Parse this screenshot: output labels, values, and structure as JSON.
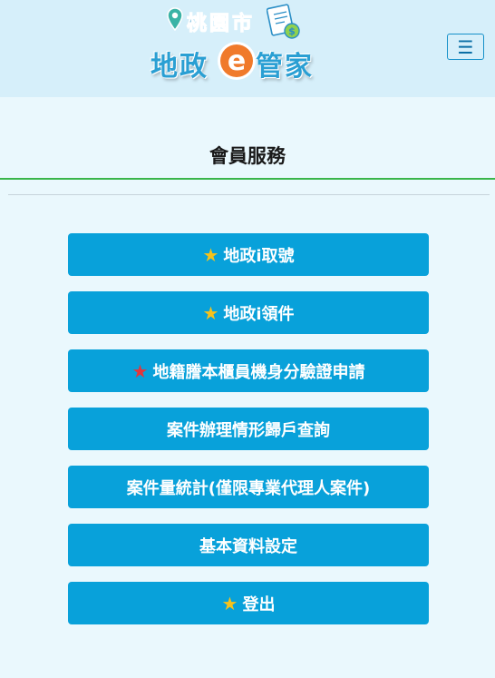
{
  "header": {
    "logo_top": "桃園市",
    "logo_main_left": "地政",
    "logo_e": "e",
    "logo_main_right": "管家",
    "menu_icon": "hamburger-icon"
  },
  "page": {
    "title": "會員服務"
  },
  "colors": {
    "header_bg": "#d6effa",
    "page_bg": "#eaf8fd",
    "button_bg": "#08a1da",
    "title_underline": "#3ab54a",
    "star_gold": "#f6c21b",
    "star_red": "#e4353b"
  },
  "buttons": [
    {
      "label": "地政i取號",
      "star": "★",
      "star_color": "gold"
    },
    {
      "label": "地政i領件",
      "star": "★",
      "star_color": "gold"
    },
    {
      "label": "地籍謄本櫃員機身分驗證申請",
      "star": "★",
      "star_color": "red"
    },
    {
      "label": "案件辦理情形歸戶查詢"
    },
    {
      "label": "案件量統計(僅限專業代理人案件)"
    },
    {
      "label": "基本資料設定"
    },
    {
      "label": "登出",
      "star": "★",
      "star_color": "gold"
    }
  ]
}
